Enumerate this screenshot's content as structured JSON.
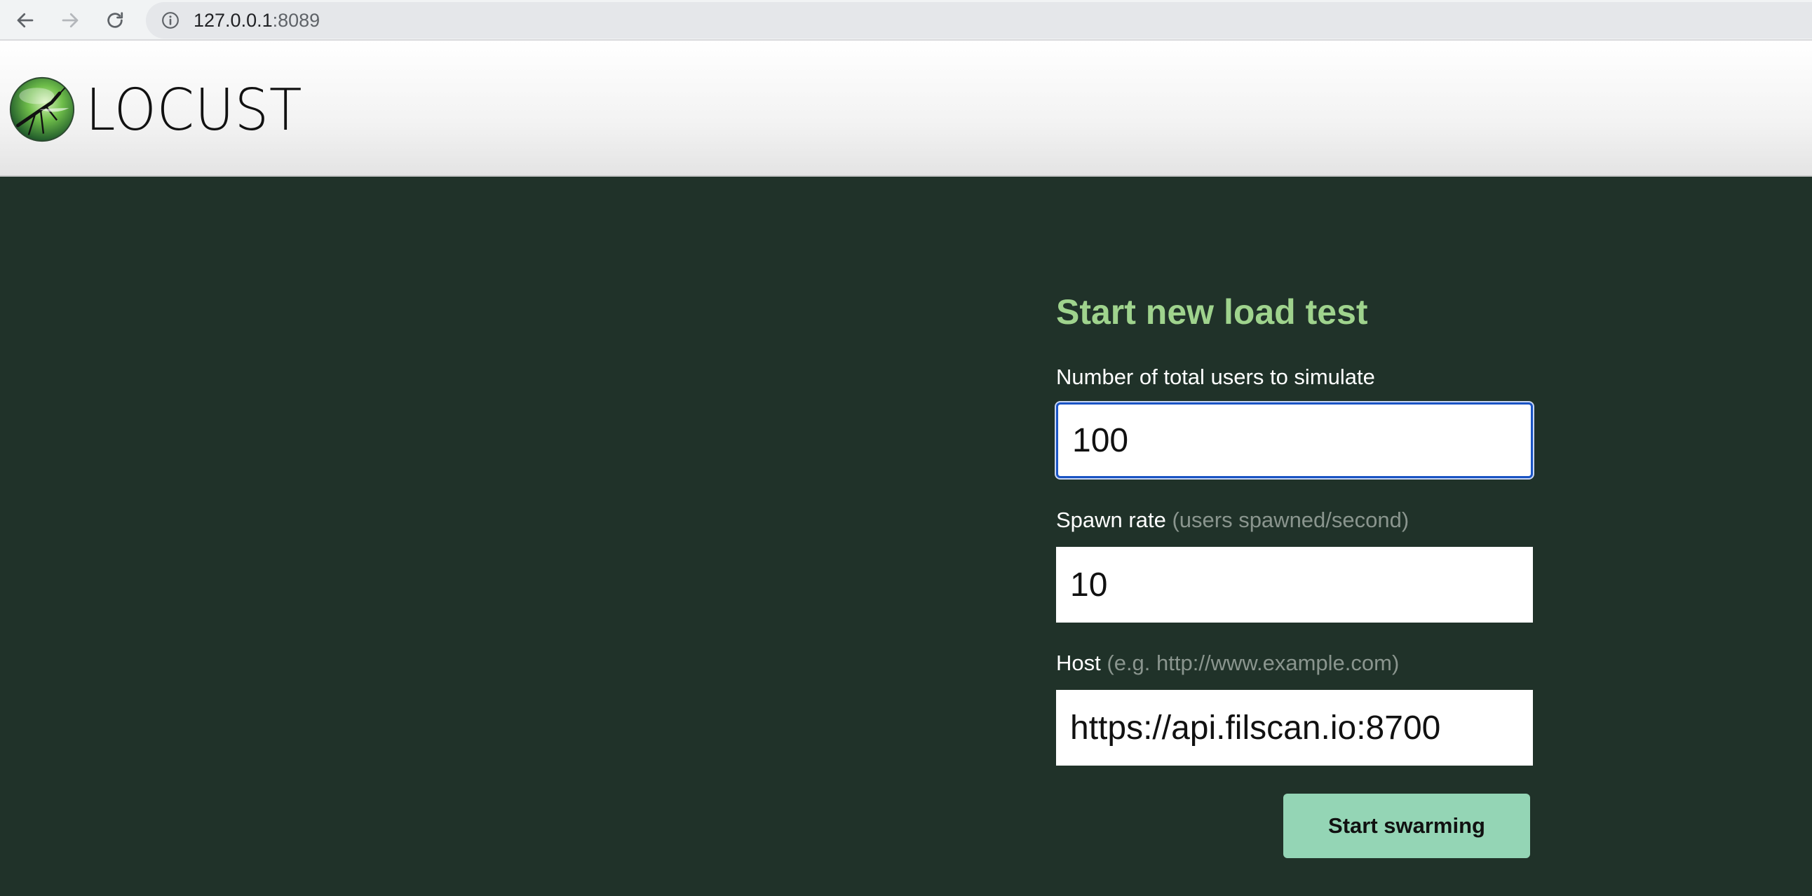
{
  "browser": {
    "url_host": "127.0.0.1",
    "url_port": ":8089"
  },
  "app": {
    "brand": "LOCUST"
  },
  "form": {
    "title": "Start new load test",
    "users_label": "Number of total users to simulate",
    "users_value": "100",
    "spawn_label": "Spawn rate",
    "spawn_hint": "(users spawned/second)",
    "spawn_value": "10",
    "host_label": "Host",
    "host_hint": "(e.g. http://www.example.com)",
    "host_value": "https://api.filscan.io:8700",
    "submit_label": "Start swarming"
  },
  "colors": {
    "background": "#203229",
    "title": "#9fd38d",
    "button": "#94d5b5",
    "focus_border": "#1a54c4"
  }
}
